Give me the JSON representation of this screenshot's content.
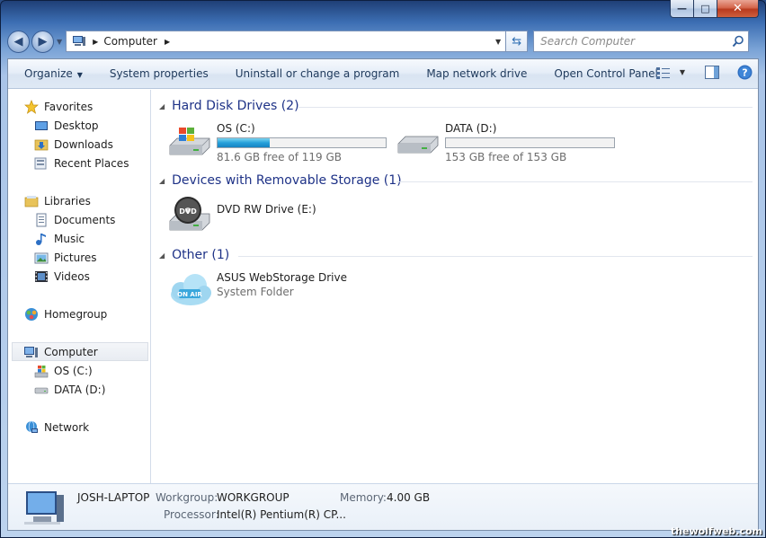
{
  "window": {
    "caption": {
      "minimize": "—",
      "maximize": "□",
      "close": "✕"
    }
  },
  "address": {
    "crumbs": [
      "Computer"
    ]
  },
  "search": {
    "placeholder": "Search Computer"
  },
  "toolbar": {
    "items": [
      "Organize",
      "System properties",
      "Uninstall or change a program",
      "Map network drive",
      "Open Control Panel"
    ]
  },
  "sidebar": {
    "favorites": {
      "label": "Favorites",
      "items": [
        "Desktop",
        "Downloads",
        "Recent Places"
      ]
    },
    "libraries": {
      "label": "Libraries",
      "items": [
        "Documents",
        "Music",
        "Pictures",
        "Videos"
      ]
    },
    "homegroup": "Homegroup",
    "computer": {
      "label": "Computer",
      "items": [
        "OS (C:)",
        "DATA (D:)"
      ]
    },
    "network": "Network"
  },
  "groups": {
    "hdd": "Hard Disk Drives (2)",
    "removable": "Devices with Removable Storage (1)",
    "other": "Other (1)"
  },
  "drives": [
    {
      "name": "OS (C:)",
      "free": "81.6 GB free of 119 GB",
      "used_fraction": 0.31
    },
    {
      "name": "DATA (D:)",
      "free": "153 GB free of 153 GB",
      "used_fraction": 0.0
    }
  ],
  "removable": {
    "name": "DVD RW Drive (E:)",
    "icon_label": "DVD"
  },
  "other": {
    "name": "ASUS WebStorage Drive",
    "subtitle": "System Folder",
    "icon_label": "ON AIR"
  },
  "details": {
    "computer_name": "JOSH-LAPTOP",
    "workgroup_label": "Workgroup:",
    "workgroup": "WORKGROUP",
    "memory_label": "Memory:",
    "memory": "4.00 GB",
    "processor_label": "Processor:",
    "processor": "Intel(R) Pentium(R) CP..."
  },
  "watermark": "thewolfweb.com"
}
